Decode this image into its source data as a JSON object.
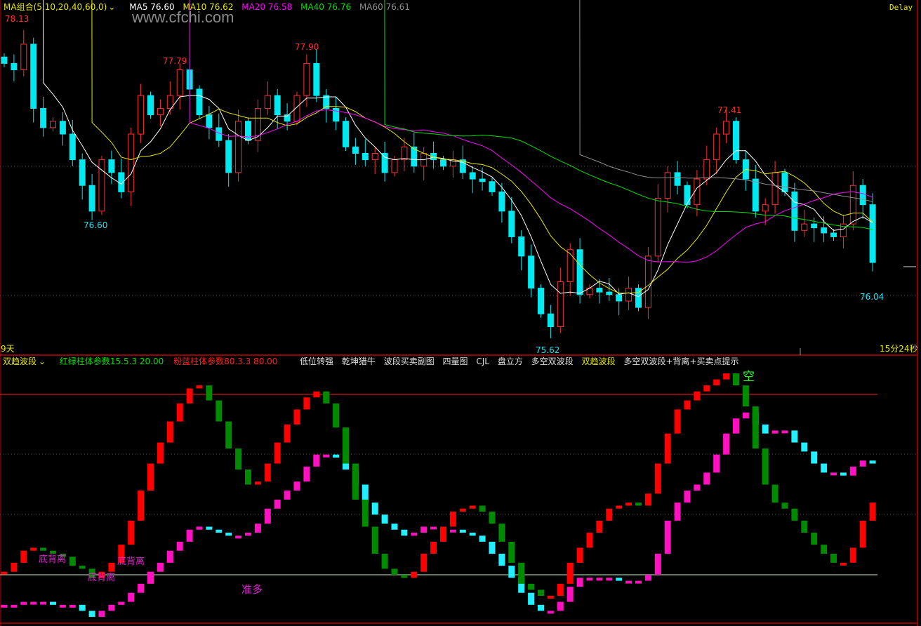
{
  "header": {
    "ma_group_label": "MA组合(5,10,20,40,60,0)",
    "ma_values": [
      {
        "label": "MA5 76.60",
        "color": "#ffffff"
      },
      {
        "label": "MA10 76.62",
        "color": "#e8e800"
      },
      {
        "label": "MA20 76.58",
        "color": "#ff00ff"
      },
      {
        "label": "MA40 76.76",
        "color": "#00e000"
      },
      {
        "label": "MA60 76.61",
        "color": "#909090"
      }
    ],
    "delay": "Delay",
    "watermark": "www.cfchi.com"
  },
  "price_labels": {
    "high1": "78.13",
    "high2": "77.79",
    "high3": "77.90",
    "high4": "77.41",
    "low1": "76.60",
    "low2": "75.62",
    "low3": "76.04"
  },
  "footer_left": "9天",
  "countdown": "15分24秒",
  "indicator_header": {
    "name": "双趋波段",
    "param1": "红绿柱体参数15.5.3 20.00",
    "param2": "粉蓝柱体参数80.3.3 80.00",
    "menu": [
      "低位转强",
      "乾坤猎牛",
      "波段买卖副图",
      "四量图",
      "CJL",
      "盘立方",
      "多空双波段",
      "双趋波段",
      "多空双波段+背离+买卖点提示"
    ],
    "active_menu_index": 7
  },
  "annotations": {
    "bottom_div": "底背离",
    "ready_long": "准多",
    "short": "空"
  },
  "colors": {
    "up": "#ff3030",
    "down": "#00e8f0",
    "red_bar": "#ff0000",
    "green_bar": "#008a00",
    "pink_bar": "#ff10c0",
    "cyan_bar": "#20f0ff",
    "axis": "#c00000"
  },
  "chart_data": [
    {
      "type": "candlestick",
      "title": "15分钟K线",
      "ylim": [
        75.5,
        78.3
      ],
      "grid": "dotted horizontal",
      "closes": [
        77.8,
        77.75,
        77.95,
        77.45,
        77.3,
        77.35,
        77.25,
        77.05,
        76.85,
        76.65,
        77.05,
        76.95,
        76.8,
        77.25,
        77.55,
        77.4,
        77.45,
        77.55,
        77.75,
        77.6,
        77.4,
        77.3,
        77.2,
        76.95,
        77.35,
        77.2,
        77.45,
        77.55,
        77.4,
        77.35,
        77.55,
        77.8,
        77.55,
        77.45,
        77.35,
        77.15,
        77.1,
        77.05,
        77.1,
        76.95,
        77.05,
        77.15,
        77.0,
        77.1,
        77.05,
        77.0,
        77.05,
        76.95,
        76.9,
        76.88,
        76.8,
        76.65,
        76.45,
        76.3,
        76.05,
        75.85,
        75.75,
        76.1,
        76.35,
        76.0,
        76.05,
        76.02,
        76.0,
        75.95,
        76.05,
        75.9,
        76.3,
        76.75,
        76.95,
        76.85,
        76.7,
        76.9,
        77.05,
        77.25,
        77.35,
        77.05,
        76.9,
        76.65,
        76.7,
        76.95,
        76.8,
        76.5,
        76.55,
        76.52,
        76.48,
        76.45,
        76.55,
        76.85,
        76.7,
        76.25
      ],
      "ma_periods": [
        5,
        10,
        20,
        40,
        60
      ]
    },
    {
      "type": "bar",
      "title": "双趋波段",
      "ylim": [
        4,
        93
      ],
      "reference_lines": [
        20,
        80
      ],
      "series": [
        {
          "name": "红绿柱",
          "values": [
            21,
            24,
            28,
            29,
            28,
            27,
            26,
            23,
            22,
            19,
            21,
            24,
            30,
            38,
            48,
            57,
            64,
            71,
            77,
            82,
            83,
            78,
            71,
            62,
            55,
            50,
            51,
            57,
            64,
            70,
            75,
            79,
            81,
            77,
            69,
            57,
            45,
            36,
            27,
            22,
            20,
            19,
            21,
            27,
            31,
            36,
            41,
            42,
            43,
            41,
            37,
            31,
            24,
            17,
            15,
            13,
            13,
            17,
            24,
            29,
            34,
            38,
            42,
            43,
            44,
            43,
            47,
            57,
            67,
            75,
            78,
            81,
            83,
            85,
            87,
            83,
            76,
            62,
            50,
            44,
            42,
            38,
            34,
            30,
            27,
            24,
            24,
            29,
            38,
            44
          ]
        },
        {
          "name": "粉蓝柱",
          "values": [
            10,
            10,
            11,
            11,
            11,
            10,
            10,
            10,
            8,
            6,
            8,
            10,
            11,
            14,
            17,
            21,
            24,
            28,
            31,
            35,
            36,
            35,
            34,
            33,
            33,
            34,
            37,
            42,
            45,
            48,
            51,
            56,
            60,
            60,
            59,
            55,
            50,
            44,
            40,
            37,
            35,
            33,
            34,
            36,
            36,
            35,
            35,
            34,
            33,
            31,
            27,
            23,
            19,
            14,
            10,
            8,
            8,
            11,
            16,
            19,
            19,
            19,
            19,
            18,
            18,
            18,
            20,
            27,
            38,
            44,
            48,
            50,
            54,
            60,
            67,
            72,
            74,
            70,
            67,
            68,
            68,
            64,
            61,
            57,
            54,
            54,
            53,
            56,
            58,
            57
          ]
        }
      ]
    }
  ]
}
